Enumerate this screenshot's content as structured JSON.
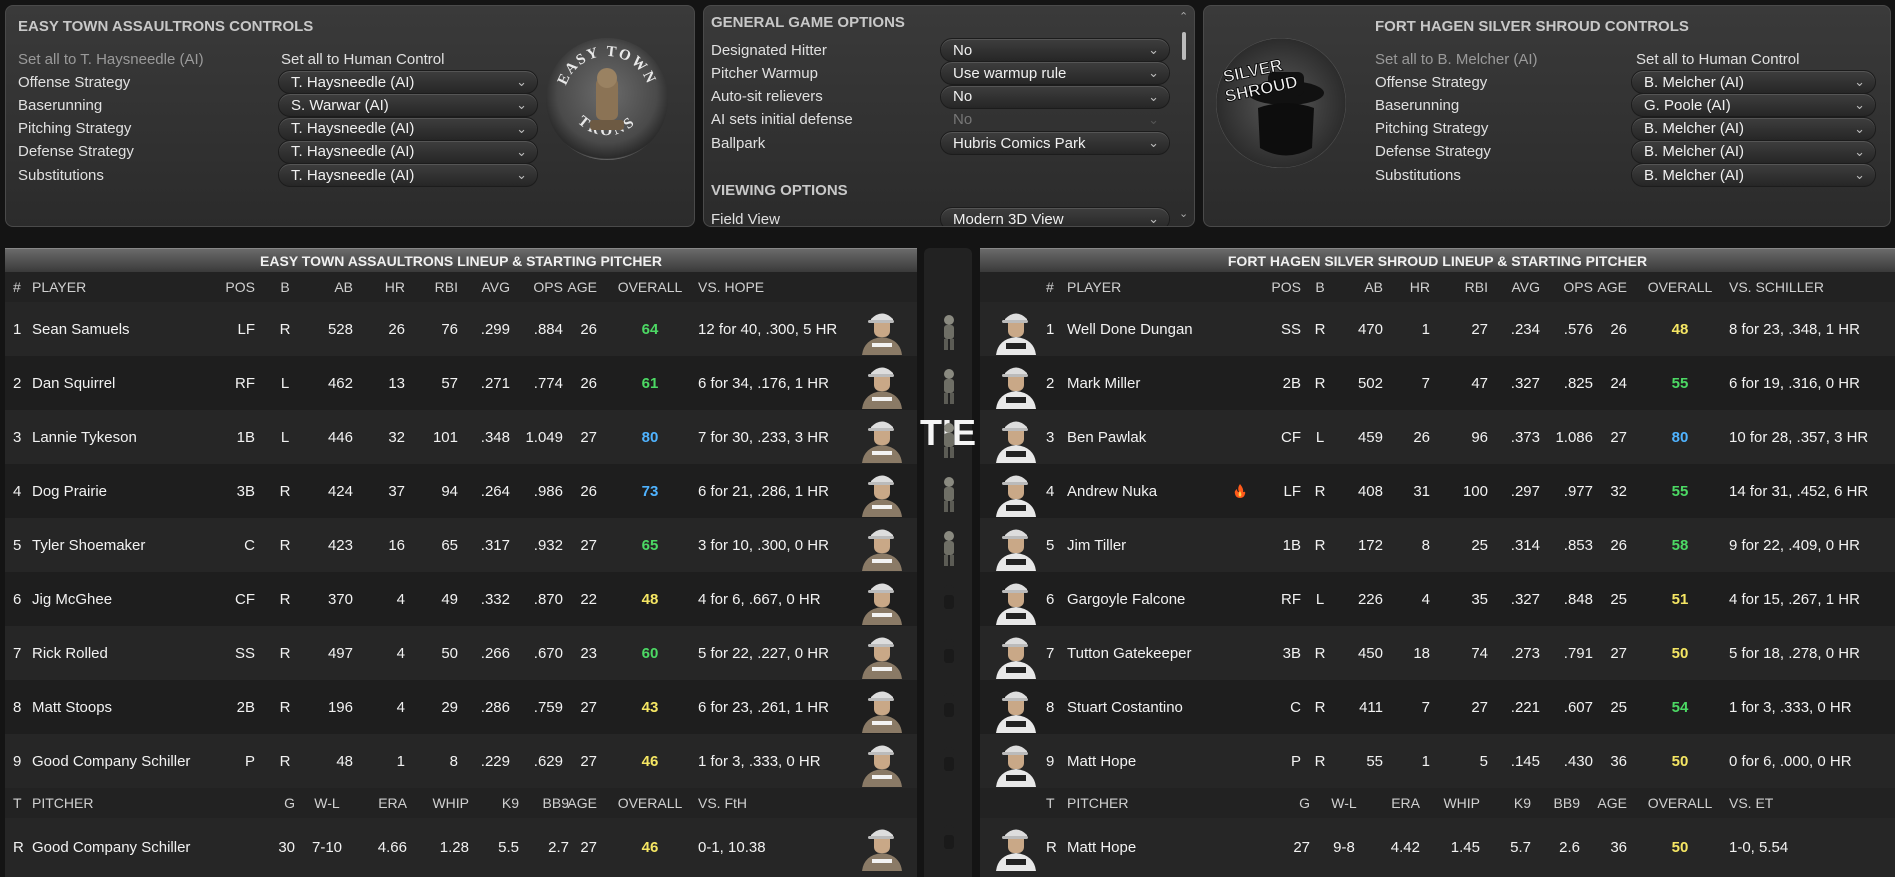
{
  "left_panel": {
    "title": "EASY TOWN ASSAULTRONS CONTROLS",
    "set_ai": "Set all to T. Haysneedle (AI)",
    "set_human": "Set all to Human Control",
    "rows": [
      {
        "label": "Offense Strategy",
        "value": "T. Haysneedle (AI)"
      },
      {
        "label": "Baserunning",
        "value": "S. Warwar (AI)"
      },
      {
        "label": "Pitching Strategy",
        "value": "T. Haysneedle (AI)"
      },
      {
        "label": "Defense Strategy",
        "value": "T. Haysneedle (AI)"
      },
      {
        "label": "Substitutions",
        "value": "T. Haysneedle (AI)"
      }
    ],
    "logo_top": "EASY TOWN",
    "logo_bottom": "TRONS"
  },
  "mid_panel": {
    "title": "GENERAL GAME OPTIONS",
    "rows": [
      {
        "label": "Designated Hitter",
        "value": "No"
      },
      {
        "label": "Pitcher Warmup",
        "value": "Use warmup rule"
      },
      {
        "label": "Auto-sit relievers",
        "value": "No"
      },
      {
        "label": "AI sets initial defense",
        "value": "No"
      },
      {
        "label": "Ballpark",
        "value": "Hubris Comics Park"
      }
    ],
    "viewing_title": "VIEWING OPTIONS",
    "field_view_label": "Field View",
    "field_view_value": "Modern 3D View"
  },
  "right_panel": {
    "title": "FORT HAGEN SILVER SHROUD CONTROLS",
    "set_ai": "Set all to B. Melcher (AI)",
    "set_human": "Set all to Human Control",
    "rows": [
      {
        "label": "Offense Strategy",
        "value": "B. Melcher (AI)"
      },
      {
        "label": "Baserunning",
        "value": "G. Poole (AI)"
      },
      {
        "label": "Pitching Strategy",
        "value": "B. Melcher (AI)"
      },
      {
        "label": "Defense Strategy",
        "value": "B. Melcher (AI)"
      },
      {
        "label": "Substitutions",
        "value": "B. Melcher (AI)"
      }
    ],
    "logo_text_1": "SILVER",
    "logo_text_2": "SHROUD"
  },
  "tie_label": "TIE",
  "left_table": {
    "title": "EASY TOWN ASSAULTRONS LINEUP & STARTING PITCHER",
    "headers": [
      "#",
      "PLAYER",
      "POS",
      "B",
      "AB",
      "HR",
      "RBI",
      "AVG",
      "OPS",
      "AGE",
      "OVERALL",
      "VS. HOPE"
    ],
    "players": [
      [
        "1",
        "Sean Samuels",
        "LF",
        "R",
        "528",
        "26",
        "76",
        ".299",
        ".884",
        "26",
        "64",
        "12 for 40, .300, 5 HR"
      ],
      [
        "2",
        "Dan Squirrel",
        "RF",
        "L",
        "462",
        "13",
        "57",
        ".271",
        ".774",
        "26",
        "61",
        "6 for 34, .176, 1 HR"
      ],
      [
        "3",
        "Lannie Tykeson",
        "1B",
        "L",
        "446",
        "32",
        "101",
        ".348",
        "1.049",
        "27",
        "80",
        "7 for 30, .233, 3 HR"
      ],
      [
        "4",
        "Dog Prairie",
        "3B",
        "R",
        "424",
        "37",
        "94",
        ".264",
        ".986",
        "26",
        "73",
        "6 for 21, .286, 1 HR"
      ],
      [
        "5",
        "Tyler Shoemaker",
        "C",
        "R",
        "423",
        "16",
        "65",
        ".317",
        ".932",
        "27",
        "65",
        "3 for 10, .300, 0 HR"
      ],
      [
        "6",
        "Jig McGhee",
        "CF",
        "R",
        "370",
        "4",
        "49",
        ".332",
        ".870",
        "22",
        "48",
        "4 for 6, .667, 0 HR"
      ],
      [
        "7",
        "Rick Rolled",
        "SS",
        "R",
        "497",
        "4",
        "50",
        ".266",
        ".670",
        "23",
        "60",
        "5 for 22, .227, 0 HR"
      ],
      [
        "8",
        "Matt Stoops",
        "2B",
        "R",
        "196",
        "4",
        "29",
        ".286",
        ".759",
        "27",
        "43",
        "6 for 23, .261, 1 HR"
      ],
      [
        "9",
        "Good Company Schiller",
        "P",
        "R",
        "48",
        "1",
        "8",
        ".229",
        ".629",
        "27",
        "46",
        "1 for 3, .333, 0 HR"
      ]
    ],
    "pitcher_headers": [
      "T",
      "PITCHER",
      "G",
      "W-L",
      "ERA",
      "WHIP",
      "K9",
      "BB9",
      "AGE",
      "OVERALL",
      "VS. FtH"
    ],
    "pitcher": [
      "R",
      "Good Company Schiller",
      "30",
      "7-10",
      "4.66",
      "1.28",
      "5.5",
      "2.7",
      "27",
      "46",
      "0-1, 10.38"
    ]
  },
  "right_table": {
    "title": "FORT HAGEN SILVER SHROUD LINEUP & STARTING PITCHER",
    "headers": [
      "#",
      "PLAYER",
      "POS",
      "B",
      "AB",
      "HR",
      "RBI",
      "AVG",
      "OPS",
      "AGE",
      "OVERALL",
      "VS. SCHILLER"
    ],
    "players": [
      [
        "1",
        "Well Done Dungan",
        "SS",
        "R",
        "470",
        "1",
        "27",
        ".234",
        ".576",
        "26",
        "48",
        "8 for 23, .348, 1 HR"
      ],
      [
        "2",
        "Mark Miller",
        "2B",
        "R",
        "502",
        "7",
        "47",
        ".327",
        ".825",
        "24",
        "55",
        "6 for 19, .316, 0 HR"
      ],
      [
        "3",
        "Ben Pawlak",
        "CF",
        "L",
        "459",
        "26",
        "96",
        ".373",
        "1.086",
        "27",
        "80",
        "10 for 28, .357, 3 HR"
      ],
      [
        "4",
        "Andrew Nuka",
        "LF",
        "R",
        "408",
        "31",
        "100",
        ".297",
        ".977",
        "32",
        "55",
        "14 for 31, .452, 6 HR"
      ],
      [
        "5",
        "Jim Tiller",
        "1B",
        "R",
        "172",
        "8",
        "25",
        ".314",
        ".853",
        "26",
        "58",
        "9 for 22, .409, 0 HR"
      ],
      [
        "6",
        "Gargoyle Falcone",
        "RF",
        "L",
        "226",
        "4",
        "35",
        ".327",
        ".848",
        "25",
        "51",
        "4 for 15, .267, 1 HR"
      ],
      [
        "7",
        "Tutton Gatekeeper",
        "3B",
        "R",
        "450",
        "18",
        "74",
        ".273",
        ".791",
        "27",
        "50",
        "5 for 18, .278, 0 HR"
      ],
      [
        "8",
        "Stuart Costantino",
        "C",
        "R",
        "411",
        "7",
        "27",
        ".221",
        ".607",
        "25",
        "54",
        "1 for 3, .333, 0 HR"
      ],
      [
        "9",
        "Matt Hope",
        "P",
        "R",
        "55",
        "1",
        "5",
        ".145",
        ".430",
        "36",
        "50",
        "0 for 6, .000, 0 HR"
      ]
    ],
    "pitcher_headers": [
      "T",
      "PITCHER",
      "G",
      "W-L",
      "ERA",
      "WHIP",
      "K9",
      "BB9",
      "AGE",
      "OVERALL",
      "VS. ET"
    ],
    "pitcher": [
      "R",
      "Matt Hope",
      "27",
      "9-8",
      "4.42",
      "1.45",
      "5.7",
      "2.6",
      "36",
      "50",
      "1-0, 5.54"
    ]
  },
  "hot_icon": "fire-icon",
  "colors": {
    "green": "#4cd964",
    "blue": "#4fb3ff",
    "yellow": "#f5e663"
  }
}
